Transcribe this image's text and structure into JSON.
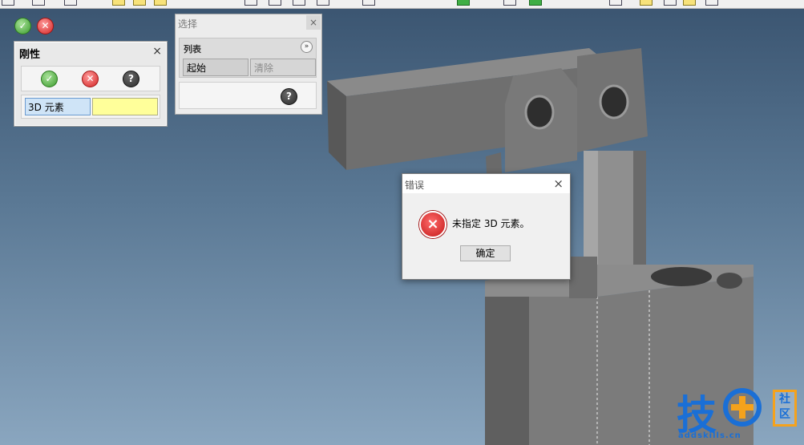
{
  "float_controls": {
    "ok_icon": "check-icon",
    "cancel_icon": "x-icon"
  },
  "rigidity_panel": {
    "title": "刚性",
    "close_label": "×",
    "field_label": "3D 元素",
    "help_glyph": "?"
  },
  "selection_panel": {
    "title": "选择",
    "close_label": "×",
    "group_label": "列表",
    "expand_glyph": "»",
    "start_button": "起始",
    "clear_button": "清除",
    "help_glyph": "?"
  },
  "error_dialog": {
    "title": "错误",
    "close_label": "×",
    "message": "未指定 3D 元素。",
    "ok_button": "确定",
    "icon_glyph": "×"
  },
  "watermark": {
    "brand_char": "技",
    "badge_line1": "社",
    "badge_line2": "区",
    "url": "addskills.cn"
  },
  "colors": {
    "accent_blue": "#1a6fd6",
    "warn_orange": "#f5a21c",
    "field_highlight": "#ffff9a",
    "error_red": "#d32222"
  }
}
